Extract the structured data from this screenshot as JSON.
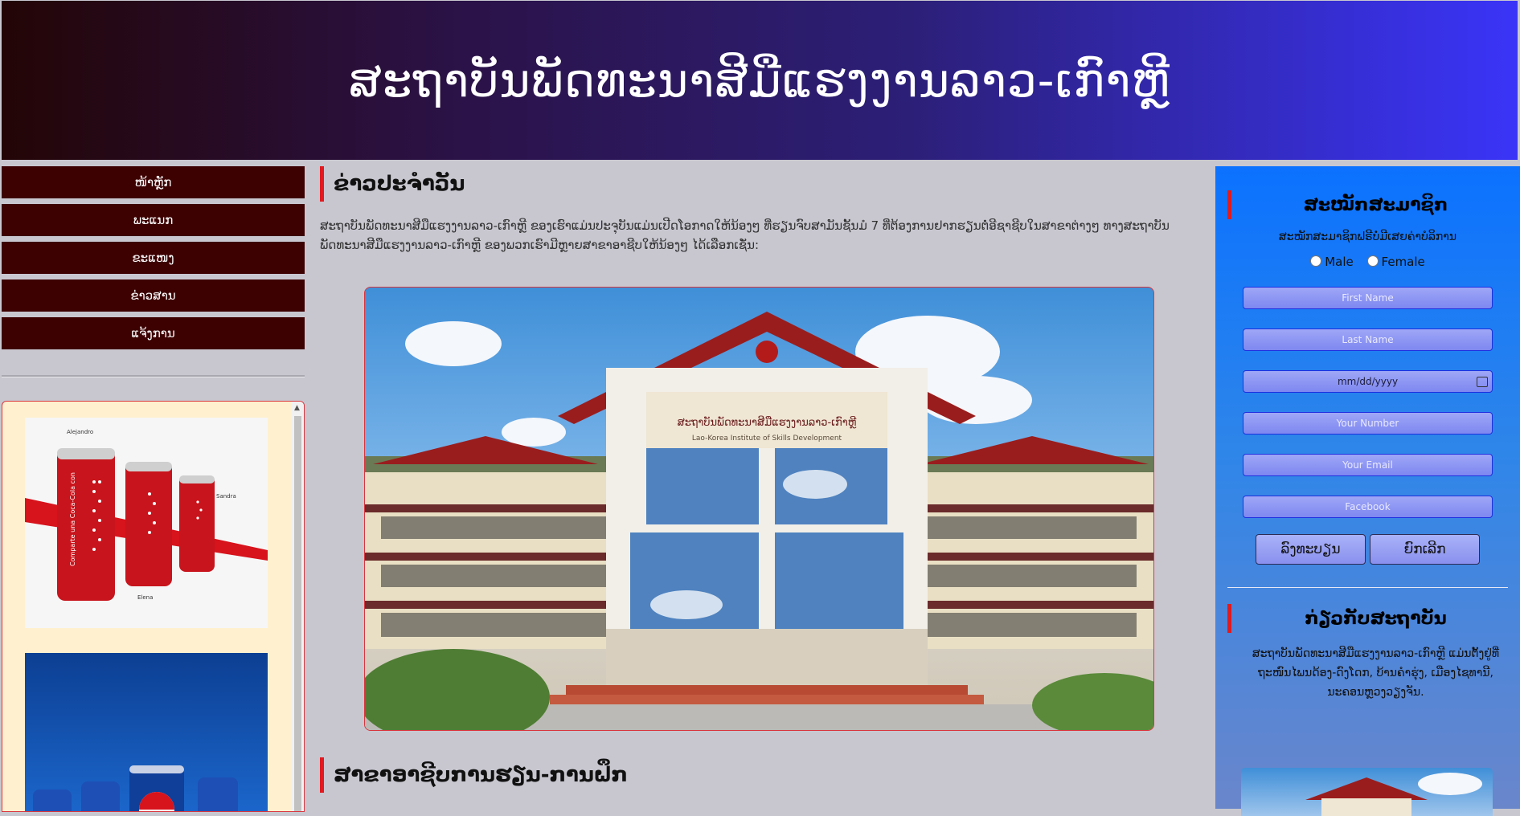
{
  "header": {
    "title": "ສະຖາບັນພັດທະນາສີມືແຮງງານລາວ-ເກົາຫຼີ"
  },
  "nav": {
    "items": [
      "ໜ້າຫຼັກ",
      "ພະແນກ",
      "ຂະແໜງ",
      "ຂ່າວສານ",
      "ແຈ້ງການ"
    ]
  },
  "ads": {
    "ad1": {
      "name_left": "Alejandro",
      "name_right": "Sandra",
      "name_bottom": "Elena",
      "can_text": "Comparte una Coca-Cola con"
    }
  },
  "main": {
    "news_title": "ຂ່າວປະຈຳວັນ",
    "intro": "ສະຖາບັນພັດທະນາສີມືແຮງງານລາວ-ເກົາຫຼີ ຂອງເຮົາແມ່ນປະຈຸບັນແມ່ນເປີດໂອກາດໃຫ້ນ້ອງໆ ທີ່ຮຽນຈົບສາມັນຊັ້ນມໍ 7 ທີ່ຕ້ອງການຢາກຮຽນຕໍ່ອີຊາຊີບໃນສາຂາຕ່າງໆ ທາງສະຖາບັນພັດທະນາສີມືແຮງງານລາວ-ເກົາຫຼີ ຂອງພວກເຮົາມີຫຼາຍສາຂາອາຊີບໃຫ້ນ້ອງໆ ໄດ້ເລືອກເຊັ່ນ:",
    "building_sign": "ສະຖາບັນພັດທະນາສີມືແຮງງານລາວ-ເກົາຫຼີ",
    "building_sign_en": "Lao-Korea Institute of Skills Development",
    "section2_title": "ສາຂາອາຊີບການຮຽນ-ການຝຶກ"
  },
  "register": {
    "title": "ສະໝັກສະມາຊິກ",
    "subtitle": "ສະໝັກສະມາຊິກຟຣີບໍ່ມີເສຍຄ່າບໍລິການ",
    "gender_male": "Male",
    "gender_female": "Female",
    "first_name_placeholder": "First Name",
    "last_name_placeholder": "Last Name",
    "date_placeholder": "mm/dd/yyyy",
    "number_placeholder": "Your Number",
    "email_placeholder": "Your Email",
    "facebook_placeholder": "Facebook",
    "submit_label": "ລົງທະບຽນ",
    "cancel_label": "ຍົກເລີກ"
  },
  "about": {
    "title": "ກ່ຽວກັບສະຖາບັນ",
    "text": "ສະຖາບັນພັດທະນາສີມືແຮງງານລາວ-ເກົາຫຼີ ແມ່ນຕັ້ງຢູ່ທີ່ຖະໜົນໄພນດ້ອງ-ດົງໂດກ, ບ້ານຄຳຮຸ່ງ, ເມືອງໄຊທານີ, ນະຄອນຫຼວງວຽງຈັນ."
  },
  "colors": {
    "header_start": "#230506",
    "header_end": "#3a34f8",
    "nav_bg": "#3d0102",
    "accent_red": "#e01a1f",
    "right_panel": "#0b72ff",
    "page_bg": "#c8c7d0"
  }
}
